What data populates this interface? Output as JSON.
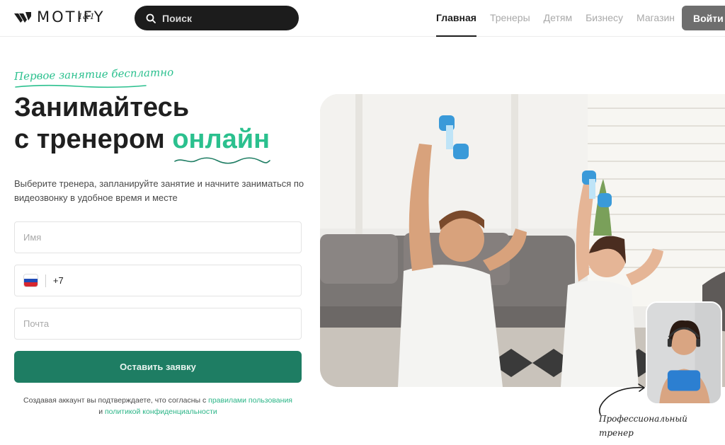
{
  "app": {
    "brand": "MOTIFY",
    "brand_sub": "1&1"
  },
  "search": {
    "placeholder": "Поиск",
    "icon": "search-icon"
  },
  "nav": {
    "items": [
      {
        "label": "Главная",
        "active": true
      },
      {
        "label": "Тренеры",
        "active": false
      },
      {
        "label": "Детям",
        "active": false
      },
      {
        "label": "Бизнесу",
        "active": false
      },
      {
        "label": "Магазин",
        "active": false
      }
    ],
    "login_label": "Войти"
  },
  "hero": {
    "promo": "Первое занятие бесплатно",
    "title_line1": "Занимайтесь",
    "title_line2_prefix": "с тренером ",
    "title_accent": "онлайн",
    "subtitle": "Выберите тренера, запланируйте занятие и начните заниматься по видеозвонку в удобное время и месте",
    "coach_label": "Профессиональный тренер"
  },
  "form": {
    "name_placeholder": "Имя",
    "phone_prefix": "+7",
    "email_placeholder": "Почта",
    "submit_label": "Оставить заявку",
    "consent_text": "Создавая аккаунт вы подтверждаете, что согласны с ",
    "consent_link1": "правилами пользования",
    "consent_and": "и",
    "consent_link2": "политикой конфиденциальности"
  },
  "colors": {
    "accent": "#2bc08e",
    "button": "#1e7d63",
    "search_bg": "#1c1c1c",
    "login_bg": "#6e6e6e"
  }
}
